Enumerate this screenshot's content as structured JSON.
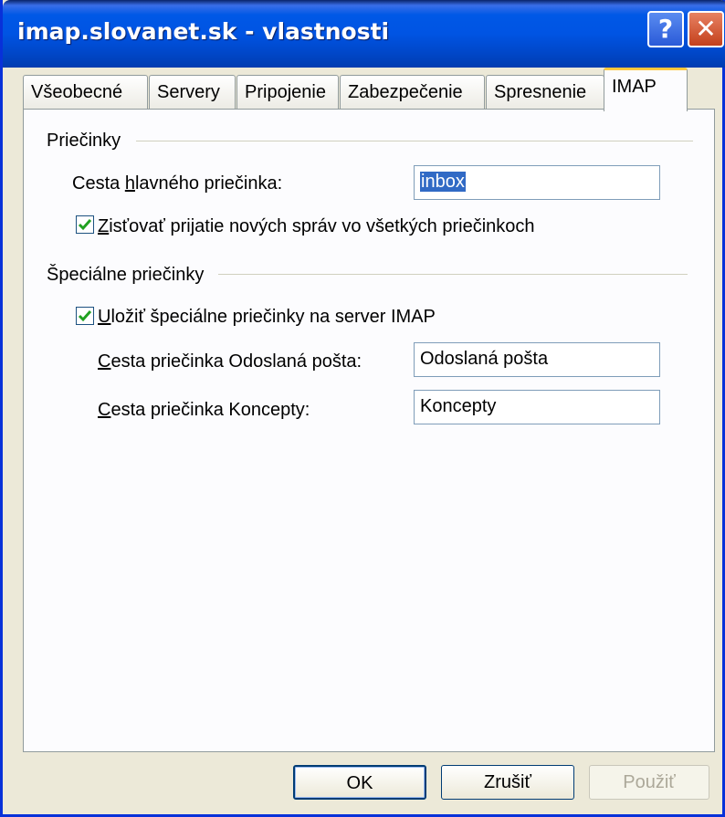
{
  "window": {
    "title": "imap.slovanet.sk - vlastnosti",
    "help_glyph": "?",
    "close_glyph": "✕"
  },
  "tabs": [
    {
      "label": "Všeobecné"
    },
    {
      "label": "Servery"
    },
    {
      "label": "Pripojenie"
    },
    {
      "label": "Zabezpečenie"
    },
    {
      "label": "Spresnenie"
    },
    {
      "label": "IMAP",
      "active": true
    }
  ],
  "folders_group": {
    "title": "Priečinky",
    "root_path_label_pre": "Cesta ",
    "root_path_label_u": "h",
    "root_path_label_post": "lavného priečinka:",
    "root_path_value": "inbox",
    "check_new_label_u": "Z",
    "check_new_label_post": "isťovať prijatie nových správ vo všetkých priečinkoch",
    "check_new_checked": true
  },
  "special_group": {
    "title": "Špeciálne priečinky",
    "store_label_u": "U",
    "store_label_post": "ložiť špeciálne priečinky na server IMAP",
    "store_checked": true,
    "sent_label_u": "C",
    "sent_label_post": "esta priečinka Odoslaná pošta:",
    "sent_value": "Odoslaná pošta",
    "drafts_label_u": "C",
    "drafts_label_post": "esta priečinka Koncepty:",
    "drafts_value": "Koncepty"
  },
  "buttons": {
    "ok": "OK",
    "cancel": "Zrušiť",
    "apply": "Použiť"
  }
}
